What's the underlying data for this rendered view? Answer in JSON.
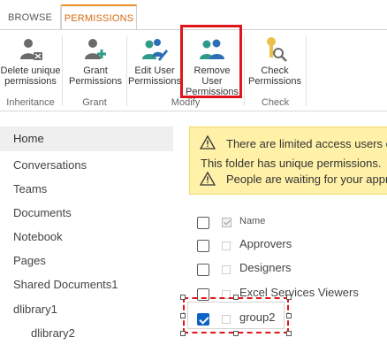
{
  "tabs": [
    {
      "label": "BROWSE",
      "active": false
    },
    {
      "label": "PERMISSIONS",
      "active": true
    }
  ],
  "ribbon": {
    "buttons": [
      {
        "label": "Delete unique\npermissions",
        "icon": "delete-unique-permissions-icon"
      },
      {
        "label": "Grant\nPermissions",
        "icon": "grant-permissions-icon"
      },
      {
        "label": "Edit User\nPermissions",
        "icon": "edit-user-permissions-icon"
      },
      {
        "label": "Remove User\nPermissions",
        "icon": "remove-user-permissions-icon"
      },
      {
        "label": "Check\nPermissions",
        "icon": "check-permissions-icon"
      }
    ],
    "groups": [
      "Inheritance",
      "Grant",
      "Modify",
      "Check"
    ]
  },
  "nav": {
    "items": [
      {
        "label": "Home",
        "selected": true
      },
      {
        "label": "Conversations"
      },
      {
        "label": "Teams"
      },
      {
        "label": "Documents"
      },
      {
        "label": "Notebook"
      },
      {
        "label": "Pages"
      },
      {
        "label": "Shared Documents1"
      },
      {
        "label": "dlibrary1"
      },
      {
        "label": "dlibrary2"
      }
    ]
  },
  "banner": {
    "line1": "There are limited access users o",
    "line2": "This folder has unique permissions.",
    "line3": "People are waiting for your appr"
  },
  "list": {
    "header": "Name",
    "rows": [
      {
        "label": "Approvers",
        "checked": false
      },
      {
        "label": "Designers",
        "checked": false
      },
      {
        "label": "Excel Services Viewers",
        "checked": false
      },
      {
        "label": "group2",
        "checked": true
      }
    ]
  },
  "colors": {
    "active_tab": "#d46a0f",
    "highlight": "#e0151b",
    "banner_bg": "#fff1a8",
    "checkbox_checked": "#0a63c9"
  }
}
